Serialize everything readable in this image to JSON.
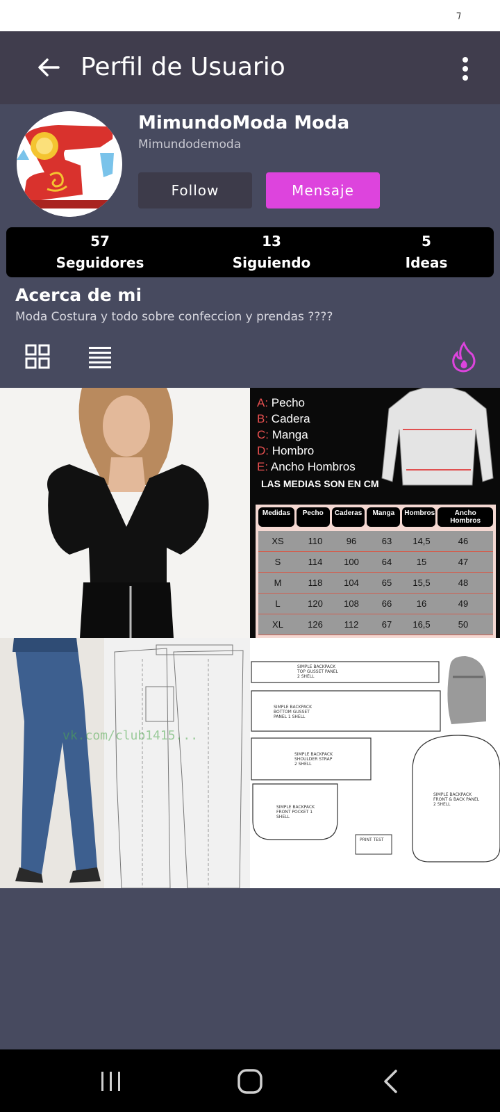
{
  "status": {
    "signal_glyph": "⁊"
  },
  "app_bar": {
    "title": "Perfil de Usuario"
  },
  "profile": {
    "name": "MimundoModa Moda",
    "handle": "Mimundodemoda",
    "follow_label": "Follow",
    "message_label": "Mensaje"
  },
  "stats": [
    {
      "value": "57",
      "label": "Seguidores"
    },
    {
      "value": "13",
      "label": "Siguiendo"
    },
    {
      "value": "5",
      "label": "Ideas"
    }
  ],
  "about": {
    "title": "Acerca de mi",
    "text": "Moda Costura y todo sobre confeccion y prendas ????"
  },
  "size_chart": {
    "legend": [
      {
        "key": "A:",
        "text": "Pecho"
      },
      {
        "key": "B:",
        "text": "Cadera"
      },
      {
        "key": "C:",
        "text": "Manga"
      },
      {
        "key": "D:",
        "text": "Hombro"
      },
      {
        "key": "E:",
        "text": "Ancho Hombros"
      }
    ],
    "note": "LAS MEDIAS SON EN CM",
    "headers": [
      "Medidas",
      "Pecho",
      "Caderas",
      "Manga",
      "Hombros",
      "Ancho Hombros"
    ],
    "rows": [
      [
        "XS",
        "110",
        "96",
        "63",
        "14,5",
        "46"
      ],
      [
        "S",
        "114",
        "100",
        "64",
        "15",
        "47"
      ],
      [
        "M",
        "118",
        "104",
        "65",
        "15,5",
        "48"
      ],
      [
        "L",
        "120",
        "108",
        "66",
        "16",
        "49"
      ],
      [
        "XL",
        "126",
        "112",
        "67",
        "16,5",
        "50"
      ]
    ]
  },
  "pattern": {
    "watermark": "vk.com/club1415..."
  },
  "backpack": {
    "labels": [
      "SIMPLE BACKPACK TOP GUSSET PANEL 2 SHELL",
      "SIMPLE BACKPACK BOTTOM GUSSET PANEL 1 SHELL",
      "SIMPLE BACKPACK SHOULDER STRAP 2 SHELL",
      "SIMPLE BACKPACK FRONT POCKET 1 SHELL",
      "SIMPLE BACKPACK FRONT & BACK PANEL 2 SHELL",
      "PRINT TEST"
    ]
  },
  "colors": {
    "app_bar": "#403d4d",
    "background": "#474a5f",
    "accent": "#dd44dd"
  }
}
